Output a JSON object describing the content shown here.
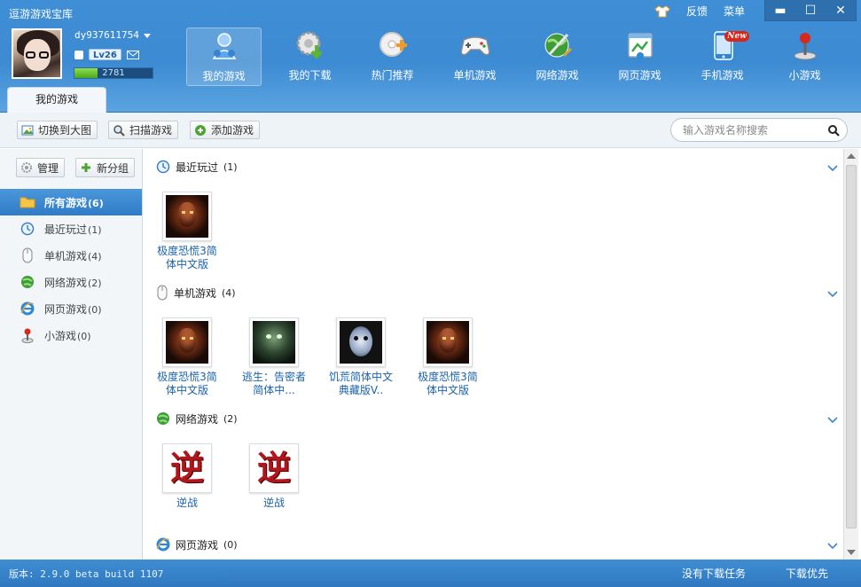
{
  "app": {
    "title": "逗游游戏宝库"
  },
  "top_links": {
    "feedback": "反馈",
    "menu": "菜单"
  },
  "window_controls": {
    "minimize": "▬",
    "maximize": "☐",
    "close": "✕"
  },
  "user": {
    "name": "dy937611754",
    "level": "Lv26",
    "exp": "2781",
    "exp_fraction": 0.3
  },
  "nav": [
    {
      "label": "我的游戏",
      "icon": "my-games-icon",
      "active": true
    },
    {
      "label": "我的下载",
      "icon": "my-downloads-icon"
    },
    {
      "label": "热门推荐",
      "icon": "hot-recommend-icon"
    },
    {
      "label": "单机游戏",
      "icon": "gamepad-icon"
    },
    {
      "label": "网络游戏",
      "icon": "online-games-icon"
    },
    {
      "label": "网页游戏",
      "icon": "web-games-icon"
    },
    {
      "label": "手机游戏",
      "icon": "phone-icon",
      "badge": "New"
    },
    {
      "label": "小游戏",
      "icon": "joystick-icon"
    }
  ],
  "tab": {
    "label": "我的游戏"
  },
  "toolbar": {
    "switch_label": "切换到大图",
    "scan_label": "扫描游戏",
    "add_label": "添加游戏",
    "search_placeholder": "输入游戏名称搜索"
  },
  "sidebar": {
    "manage_label": "管理",
    "new_group_label": "新分组",
    "items": [
      {
        "label": "所有游戏",
        "count": "(6)",
        "icon": "folder-icon",
        "active": true
      },
      {
        "label": "最近玩过",
        "count": "(1)",
        "icon": "clock-icon"
      },
      {
        "label": "单机游戏",
        "count": "(4)",
        "icon": "mouse-icon"
      },
      {
        "label": "网络游戏",
        "count": "(2)",
        "icon": "globe-icon"
      },
      {
        "label": "网页游戏",
        "count": "(0)",
        "icon": "ie-icon"
      },
      {
        "label": "小游戏",
        "count": "(0)",
        "icon": "joystick-icon"
      }
    ]
  },
  "sections": [
    {
      "title": "最近玩过",
      "count": "(1)",
      "icon": "clock-icon",
      "games": [
        {
          "name": "极度恐慌3简体中文版",
          "icon": "fear3"
        }
      ]
    },
    {
      "title": "单机游戏",
      "count": "(4)",
      "icon": "mouse-icon",
      "games": [
        {
          "name": "极度恐慌3简体中文版",
          "icon": "fear3"
        },
        {
          "name": "逃生：告密者简体中...",
          "icon": "outlast"
        },
        {
          "name": "饥荒简体中文典藏版V..",
          "icon": "dontstarve"
        },
        {
          "name": "极度恐慌3简体中文版",
          "icon": "fear3"
        }
      ]
    },
    {
      "title": "网络游戏",
      "count": "(2)",
      "icon": "globe-icon",
      "games": [
        {
          "name": "逆战",
          "icon": "nizhan",
          "glyph": "逆"
        },
        {
          "name": "逆战",
          "icon": "nizhan",
          "glyph": "逆"
        }
      ]
    },
    {
      "title": "网页游戏",
      "count": "(0)",
      "icon": "ie-icon",
      "games": []
    }
  ],
  "status": {
    "version": "版本: 2.9.0 beta build 1107",
    "download_tasks": "没有下载任务",
    "download_priority": "下载优先"
  }
}
